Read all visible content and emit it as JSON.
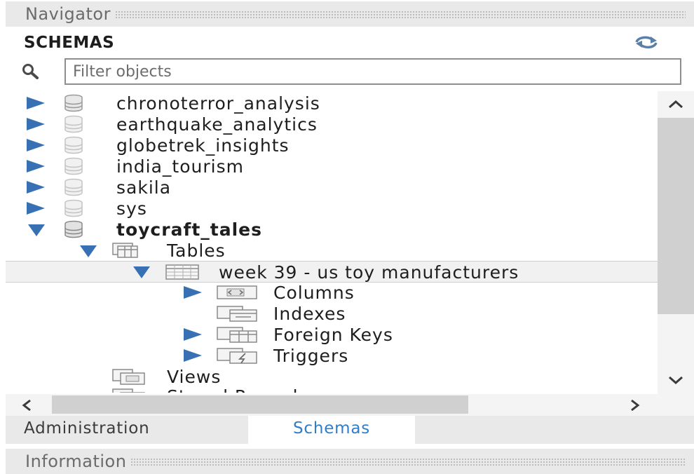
{
  "navigator": {
    "title": "Navigator"
  },
  "schemas": {
    "title": "SCHEMAS"
  },
  "filter": {
    "placeholder": "Filter objects",
    "value": ""
  },
  "tree": {
    "schemas": [
      {
        "name": "chronoterror_analysis",
        "expanded": false
      },
      {
        "name": "earthquake_analytics",
        "expanded": false
      },
      {
        "name": "globetrek_insights",
        "expanded": false
      },
      {
        "name": "india_tourism",
        "expanded": false
      },
      {
        "name": "sakila",
        "expanded": false
      },
      {
        "name": "sys",
        "expanded": false
      },
      {
        "name": "toycraft_tales",
        "expanded": true,
        "active": true
      }
    ],
    "tables_label": "Tables",
    "table": {
      "name": "week 39 - us toy manufacturers",
      "selected": true
    },
    "table_children": [
      {
        "label": "Columns",
        "expandable": true
      },
      {
        "label": "Indexes",
        "expandable": false
      },
      {
        "label": "Foreign Keys",
        "expandable": true
      },
      {
        "label": "Triggers",
        "expandable": true
      }
    ],
    "views_label": "Views",
    "stored_procedures_label": "Stored Procedures"
  },
  "tabs": [
    {
      "label": "Administration",
      "active": false
    },
    {
      "label": "Schemas",
      "active": true
    }
  ],
  "information": {
    "title": "Information"
  },
  "colors": {
    "accent": "#3771b4",
    "active_tab_text": "#2f7ec7",
    "panel_bg": "#e9e9e9"
  },
  "icons": [
    "refresh-icon",
    "search-icon",
    "database-icon",
    "tables-folder-icon",
    "table-icon",
    "columns-icon",
    "indexes-icon",
    "foreign-keys-icon",
    "triggers-icon",
    "views-icon",
    "scroll-up-icon",
    "scroll-down-icon",
    "scroll-left-icon",
    "scroll-right-icon"
  ]
}
